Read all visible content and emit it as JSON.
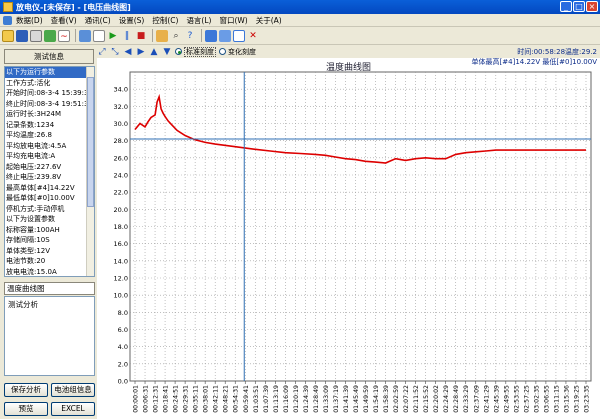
{
  "window": {
    "title": "放电仪-[未保存] - [电压曲线图]",
    "buttons": [
      "_",
      "□",
      "×"
    ]
  },
  "menubar": [
    "数据(D)",
    "查看(V)",
    "通讯(C)",
    "设置(S)",
    "控制(C)",
    "语言(L)",
    "窗口(W)",
    "关于(A)"
  ],
  "toolbar_icons": [
    "open-icon",
    "save-icon",
    "print-icon",
    "export-icon",
    "chart-icon",
    "connect-icon",
    "table-icon",
    "start-icon",
    "pause-icon",
    "stop-icon",
    "settings-icon",
    "zoom-icon",
    "tile-icon",
    "cascade-icon",
    "window-icon",
    "close-icon"
  ],
  "left_panel": {
    "info_header": "测试信息",
    "info_lines": [
      "以下为运行参数",
      "工作方式:活化",
      "开始时间:08-3-4 15:39:32",
      "终止时间:08-3-4 19:51:3",
      "运行时长:3H24M",
      "记录条数:1234",
      "平均温度:26.8",
      "平均放电电流:4.5A",
      "平均充电电流:A",
      "起始电压:227.6V",
      "终止电压:239.8V",
      "最高单体[#4]14.22V",
      "最低单体[#0]10.00V",
      "停机方式:手动停机",
      "以下为设置参数",
      "标称容量:100AH",
      "存储间隔:10S",
      "单体类型:12V",
      "电池节数:20",
      "放电电流:15.0A"
    ],
    "section_header": "温度曲线图",
    "notes_text": "测试分析",
    "buttons": {
      "save_analysis": "保存分析",
      "battery_info": "电池组信息",
      "preview": "预览",
      "excel": "EXCEL"
    }
  },
  "chart_toolbar": {
    "radio_total": "标准刻度",
    "radio_single": "变化刻度"
  },
  "chart": {
    "readout_line1": "时间:00:58:28温度:29.2",
    "readout_line2": "单体最高[#4]14.22V 最低[#0]10.00V"
  },
  "chart_data": {
    "type": "line",
    "title": "温度曲线图",
    "xlabel": "",
    "ylabel": "",
    "ylim": [
      0,
      36
    ],
    "yticks": [
      "0.0",
      "2.0",
      "4.0",
      "6.0",
      "8.0",
      "10.0",
      "12.0",
      "14.0",
      "16.0",
      "18.0",
      "20.0",
      "22.0",
      "24.0",
      "26.0",
      "28.0",
      "30.0",
      "32.0",
      "34.0"
    ],
    "x_categories": [
      "00:00:01",
      "00:06:31",
      "00:12:31",
      "00:18:41",
      "00:24:51",
      "00:29:31",
      "00:35:11",
      "00:38:01",
      "00:42:11",
      "00:48:21",
      "00:54:31",
      "00:59:41",
      "01:03:51",
      "01:07:39",
      "01:13:19",
      "01:16:09",
      "01:20:19",
      "01:24:39",
      "01:28:49",
      "01:33:09",
      "01:37:19",
      "01:41:39",
      "01:45:49",
      "01:49:59",
      "01:54:19",
      "01:58:39",
      "02:02:59",
      "02:07:22",
      "02:11:52",
      "02:15:52",
      "02:20:02",
      "02:24:29",
      "02:28:49",
      "02:33:29",
      "02:37:09",
      "02:41:29",
      "02:45:39",
      "02:49:55",
      "02:53:55",
      "02:57:25",
      "03:02:35",
      "03:06:55",
      "03:11:15",
      "03:15:36",
      "03:19:25",
      "03:23:35"
    ],
    "series": [
      {
        "color": "#dd0000",
        "x_index": [
          0,
          0.5,
          1.0,
          1.3,
          1.6,
          2.0,
          2.2,
          2.4,
          2.6,
          2.8,
          3.0,
          3.3,
          3.7,
          4.2,
          5.0,
          6.0,
          7.0,
          8.0,
          10.0,
          12.0,
          13.5,
          15.0,
          16.5,
          18.0,
          19.0,
          20.0,
          21.0,
          22.0,
          23.0,
          24.0,
          25.0,
          26.0,
          27.0,
          28.0,
          29.0,
          30.0,
          31.0,
          32.0,
          33.0,
          34.0,
          35.0,
          36.0,
          37.0,
          38.0,
          39.0,
          40.0,
          41.0,
          42.0,
          43.0,
          44.0,
          45.0
        ],
        "values": [
          29.3,
          30.0,
          29.6,
          30.2,
          30.7,
          31.0,
          32.5,
          33.1,
          31.7,
          31.2,
          30.8,
          30.3,
          29.8,
          29.2,
          28.6,
          28.1,
          27.8,
          27.6,
          27.3,
          27.0,
          26.8,
          26.6,
          26.5,
          26.4,
          26.3,
          26.1,
          25.9,
          25.8,
          25.6,
          25.5,
          25.4,
          25.9,
          25.7,
          25.9,
          26.0,
          25.9,
          25.9,
          26.4,
          26.6,
          26.7,
          26.8,
          26.9,
          26.9,
          26.9,
          26.9,
          26.9,
          26.9,
          26.9,
          26.9,
          26.9,
          26.9
        ]
      }
    ],
    "cursor": {
      "x_label": "00:58:28",
      "y": 28.2
    },
    "grid": true,
    "legend": "none"
  }
}
